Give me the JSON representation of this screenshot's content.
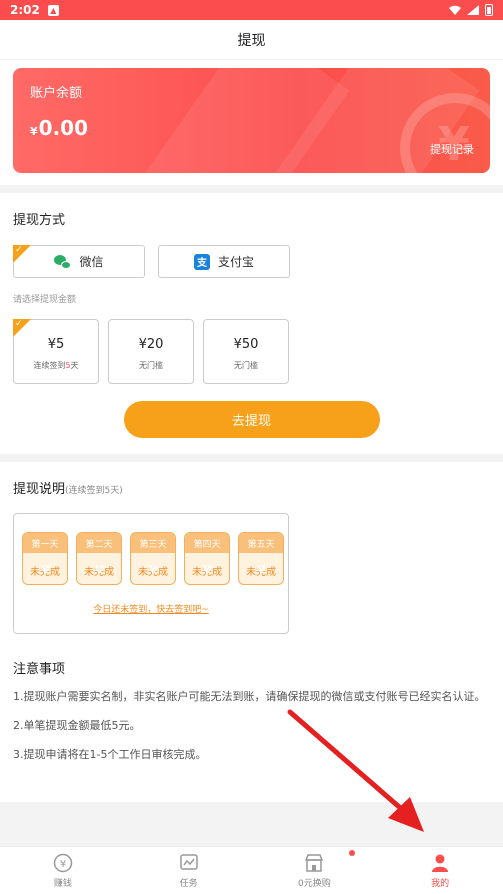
{
  "status_bar": {
    "time": "2:02",
    "app_badge": "▲"
  },
  "title": "提现",
  "balance": {
    "label": "账户余额",
    "currency": "¥",
    "amount": "0.00",
    "records_link": "提现记录"
  },
  "withdraw_method": {
    "title": "提现方式",
    "options": [
      {
        "label": "微信",
        "icon": "wechat-icon",
        "selected": true
      },
      {
        "label": "支付宝",
        "icon": "alipay-icon",
        "selected": false
      }
    ],
    "hint": "请选择提现金额"
  },
  "amounts": [
    {
      "value": "¥5",
      "sub_prefix": "连续签到",
      "sub_highlight": "5",
      "sub_suffix": "天",
      "selected": true
    },
    {
      "value": "¥20",
      "sub": "无门槛",
      "selected": false
    },
    {
      "value": "¥50",
      "sub": "无门槛",
      "selected": false
    }
  ],
  "withdraw_button": "去提现",
  "description": {
    "title": "提现说明",
    "subtitle": "(连续签到5天)",
    "days": [
      {
        "label": "第一天",
        "state": "未完成"
      },
      {
        "label": "第二天",
        "state": "未完成"
      },
      {
        "label": "第三天",
        "state": "未完成"
      },
      {
        "label": "第四天",
        "state": "未完成"
      },
      {
        "label": "第五天",
        "state": "未完成"
      }
    ],
    "checkin_link": "今日还未签到，快去签到吧~"
  },
  "notice": {
    "title": "注意事项",
    "items": [
      "1.提现账户需要实名制，非实名账户可能无法到账，请确保提现的微信或支付账号已经实名认证。",
      "2.单笔提现金额最低5元。",
      "3.提现申请将在1-5个工作日审核完成。"
    ]
  },
  "bottom_nav": [
    {
      "label": "赚钱",
      "icon": "coin-icon",
      "active": false
    },
    {
      "label": "任务",
      "icon": "task-icon",
      "active": false
    },
    {
      "label": "0元换购",
      "icon": "shop-icon",
      "active": false,
      "dot": true
    },
    {
      "label": "我的",
      "icon": "user-icon",
      "active": true
    }
  ],
  "colors": {
    "primary": "#fb4d4d",
    "accent": "#f7a11a",
    "annotation_arrow": "#e52020"
  }
}
